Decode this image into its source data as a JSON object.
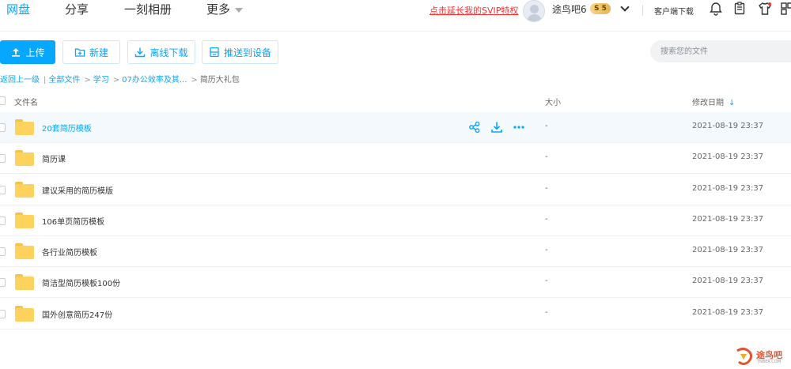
{
  "nav": {
    "tabs": [
      {
        "label": "网盘",
        "active": true
      },
      {
        "label": "分享"
      },
      {
        "label": "一刻相册"
      },
      {
        "label": "更多"
      }
    ]
  },
  "header": {
    "promo_text": "点击延长我的SVIP特权",
    "username": "途鸟吧6",
    "svip_badge": "S 5",
    "client_download": "客户端下载"
  },
  "toolbar": {
    "upload_label": "上传",
    "new_label": "新建",
    "offline_download_label": "离线下载",
    "push_device_label": "推送到设备",
    "search_placeholder": "搜索您的文件"
  },
  "breadcrumb": {
    "back": "返回上一级",
    "items": [
      "全部文件",
      "学习",
      "07办公效率及其...",
      "简历大礼包"
    ]
  },
  "table": {
    "columns": {
      "name": "文件名",
      "size": "大小",
      "date": "修改日期"
    },
    "rows": [
      {
        "name": "20套简历模板",
        "size": "-",
        "date": "2021-08-19 23:37"
      },
      {
        "name": "简历课",
        "size": "-",
        "date": "2021-08-19 23:37"
      },
      {
        "name": "建议采用的简历模版",
        "size": "-",
        "date": "2021-08-19 23:37"
      },
      {
        "name": "106单页简历模板",
        "size": "-",
        "date": "2021-08-19 23:37"
      },
      {
        "name": "各行业简历模板",
        "size": "-",
        "date": "2021-08-19 23:37"
      },
      {
        "name": "简洁型简历模板100份",
        "size": "-",
        "date": "2021-08-19 23:37"
      },
      {
        "name": "国外创意简历247份",
        "size": "-",
        "date": "2021-08-19 23:37"
      }
    ]
  },
  "watermark": {
    "text": "途鸟吧",
    "sub": "TNBER.COM"
  },
  "colors": {
    "accent": "#06a7ff",
    "promo": "#ff3333",
    "folder": "#fdd35d"
  }
}
